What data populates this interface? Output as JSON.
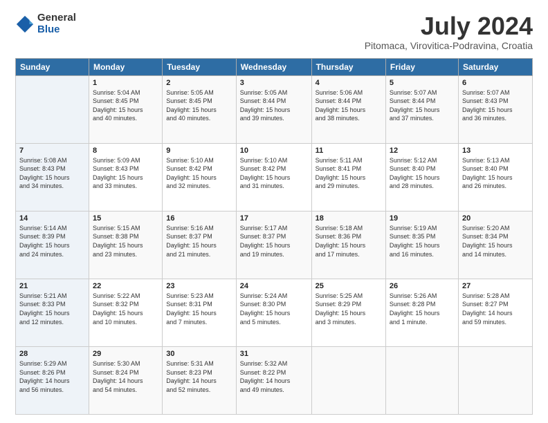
{
  "header": {
    "logo_general": "General",
    "logo_blue": "Blue",
    "title": "July 2024",
    "subtitle": "Pitomaca, Virovitica-Podravina, Croatia"
  },
  "calendar": {
    "days_of_week": [
      "Sunday",
      "Monday",
      "Tuesday",
      "Wednesday",
      "Thursday",
      "Friday",
      "Saturday"
    ],
    "weeks": [
      [
        {
          "num": "",
          "detail": ""
        },
        {
          "num": "1",
          "detail": "Sunrise: 5:04 AM\nSunset: 8:45 PM\nDaylight: 15 hours\nand 40 minutes."
        },
        {
          "num": "2",
          "detail": "Sunrise: 5:05 AM\nSunset: 8:45 PM\nDaylight: 15 hours\nand 40 minutes."
        },
        {
          "num": "3",
          "detail": "Sunrise: 5:05 AM\nSunset: 8:44 PM\nDaylight: 15 hours\nand 39 minutes."
        },
        {
          "num": "4",
          "detail": "Sunrise: 5:06 AM\nSunset: 8:44 PM\nDaylight: 15 hours\nand 38 minutes."
        },
        {
          "num": "5",
          "detail": "Sunrise: 5:07 AM\nSunset: 8:44 PM\nDaylight: 15 hours\nand 37 minutes."
        },
        {
          "num": "6",
          "detail": "Sunrise: 5:07 AM\nSunset: 8:43 PM\nDaylight: 15 hours\nand 36 minutes."
        }
      ],
      [
        {
          "num": "7",
          "detail": "Sunrise: 5:08 AM\nSunset: 8:43 PM\nDaylight: 15 hours\nand 34 minutes."
        },
        {
          "num": "8",
          "detail": "Sunrise: 5:09 AM\nSunset: 8:43 PM\nDaylight: 15 hours\nand 33 minutes."
        },
        {
          "num": "9",
          "detail": "Sunrise: 5:10 AM\nSunset: 8:42 PM\nDaylight: 15 hours\nand 32 minutes."
        },
        {
          "num": "10",
          "detail": "Sunrise: 5:10 AM\nSunset: 8:42 PM\nDaylight: 15 hours\nand 31 minutes."
        },
        {
          "num": "11",
          "detail": "Sunrise: 5:11 AM\nSunset: 8:41 PM\nDaylight: 15 hours\nand 29 minutes."
        },
        {
          "num": "12",
          "detail": "Sunrise: 5:12 AM\nSunset: 8:40 PM\nDaylight: 15 hours\nand 28 minutes."
        },
        {
          "num": "13",
          "detail": "Sunrise: 5:13 AM\nSunset: 8:40 PM\nDaylight: 15 hours\nand 26 minutes."
        }
      ],
      [
        {
          "num": "14",
          "detail": "Sunrise: 5:14 AM\nSunset: 8:39 PM\nDaylight: 15 hours\nand 24 minutes."
        },
        {
          "num": "15",
          "detail": "Sunrise: 5:15 AM\nSunset: 8:38 PM\nDaylight: 15 hours\nand 23 minutes."
        },
        {
          "num": "16",
          "detail": "Sunrise: 5:16 AM\nSunset: 8:37 PM\nDaylight: 15 hours\nand 21 minutes."
        },
        {
          "num": "17",
          "detail": "Sunrise: 5:17 AM\nSunset: 8:37 PM\nDaylight: 15 hours\nand 19 minutes."
        },
        {
          "num": "18",
          "detail": "Sunrise: 5:18 AM\nSunset: 8:36 PM\nDaylight: 15 hours\nand 17 minutes."
        },
        {
          "num": "19",
          "detail": "Sunrise: 5:19 AM\nSunset: 8:35 PM\nDaylight: 15 hours\nand 16 minutes."
        },
        {
          "num": "20",
          "detail": "Sunrise: 5:20 AM\nSunset: 8:34 PM\nDaylight: 15 hours\nand 14 minutes."
        }
      ],
      [
        {
          "num": "21",
          "detail": "Sunrise: 5:21 AM\nSunset: 8:33 PM\nDaylight: 15 hours\nand 12 minutes."
        },
        {
          "num": "22",
          "detail": "Sunrise: 5:22 AM\nSunset: 8:32 PM\nDaylight: 15 hours\nand 10 minutes."
        },
        {
          "num": "23",
          "detail": "Sunrise: 5:23 AM\nSunset: 8:31 PM\nDaylight: 15 hours\nand 7 minutes."
        },
        {
          "num": "24",
          "detail": "Sunrise: 5:24 AM\nSunset: 8:30 PM\nDaylight: 15 hours\nand 5 minutes."
        },
        {
          "num": "25",
          "detail": "Sunrise: 5:25 AM\nSunset: 8:29 PM\nDaylight: 15 hours\nand 3 minutes."
        },
        {
          "num": "26",
          "detail": "Sunrise: 5:26 AM\nSunset: 8:28 PM\nDaylight: 15 hours\nand 1 minute."
        },
        {
          "num": "27",
          "detail": "Sunrise: 5:28 AM\nSunset: 8:27 PM\nDaylight: 14 hours\nand 59 minutes."
        }
      ],
      [
        {
          "num": "28",
          "detail": "Sunrise: 5:29 AM\nSunset: 8:26 PM\nDaylight: 14 hours\nand 56 minutes."
        },
        {
          "num": "29",
          "detail": "Sunrise: 5:30 AM\nSunset: 8:24 PM\nDaylight: 14 hours\nand 54 minutes."
        },
        {
          "num": "30",
          "detail": "Sunrise: 5:31 AM\nSunset: 8:23 PM\nDaylight: 14 hours\nand 52 minutes."
        },
        {
          "num": "31",
          "detail": "Sunrise: 5:32 AM\nSunset: 8:22 PM\nDaylight: 14 hours\nand 49 minutes."
        },
        {
          "num": "",
          "detail": ""
        },
        {
          "num": "",
          "detail": ""
        },
        {
          "num": "",
          "detail": ""
        }
      ]
    ]
  }
}
